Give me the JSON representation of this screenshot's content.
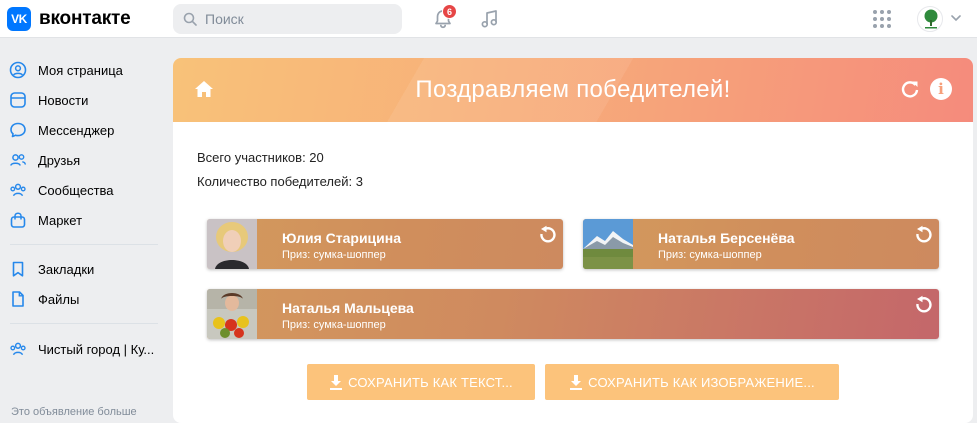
{
  "header": {
    "logo_mark": "VK",
    "logo_text": "вконтакте",
    "search_placeholder": "Поиск",
    "notifications_count": "6"
  },
  "sidebar": {
    "items": [
      {
        "label": "Моя страница",
        "icon": "user-circle-icon"
      },
      {
        "label": "Новости",
        "icon": "news-icon"
      },
      {
        "label": "Мессенджер",
        "icon": "chat-bubble-icon"
      },
      {
        "label": "Друзья",
        "icon": "friends-icon"
      },
      {
        "label": "Сообщества",
        "icon": "communities-icon"
      },
      {
        "label": "Маркет",
        "icon": "shopping-bag-icon"
      },
      {
        "label": "Закладки",
        "icon": "bookmark-icon"
      },
      {
        "label": "Файлы",
        "icon": "file-icon"
      },
      {
        "label": "Чистый город | Ку...",
        "icon": "community-icon"
      }
    ],
    "footer": "Это объявление больше"
  },
  "app": {
    "title": "Поздравляем победителей!",
    "total_participants": "Всего участников: 20",
    "winners_count": "Количество победителей: 3",
    "winners": [
      {
        "name": "Юлия Старицина",
        "prize": "Приз: сумка-шоппер",
        "photo": "woman-portrait"
      },
      {
        "name": "Наталья Берсенёва",
        "prize": "Приз: сумка-шоппер",
        "photo": "mountain-landscape"
      },
      {
        "name": "Наталья Мальцева",
        "prize": "Приз: сумка-шоппер",
        "photo": "woman-with-flowers"
      }
    ],
    "save_text_label": "СОХРАНИТЬ КАК ТЕКСТ...",
    "save_image_label": "СОХРАНИТЬ КАК ИЗОБРАЖЕНИЕ..."
  },
  "colors": {
    "vk_blue": "#0077ff",
    "banner_start": "#f8c279",
    "banner_end": "#f58b7c",
    "winner_card": "#d08e5c",
    "winner_card_end": "#c76a66",
    "save_button": "#fcc37b",
    "badge": "#e64646"
  }
}
